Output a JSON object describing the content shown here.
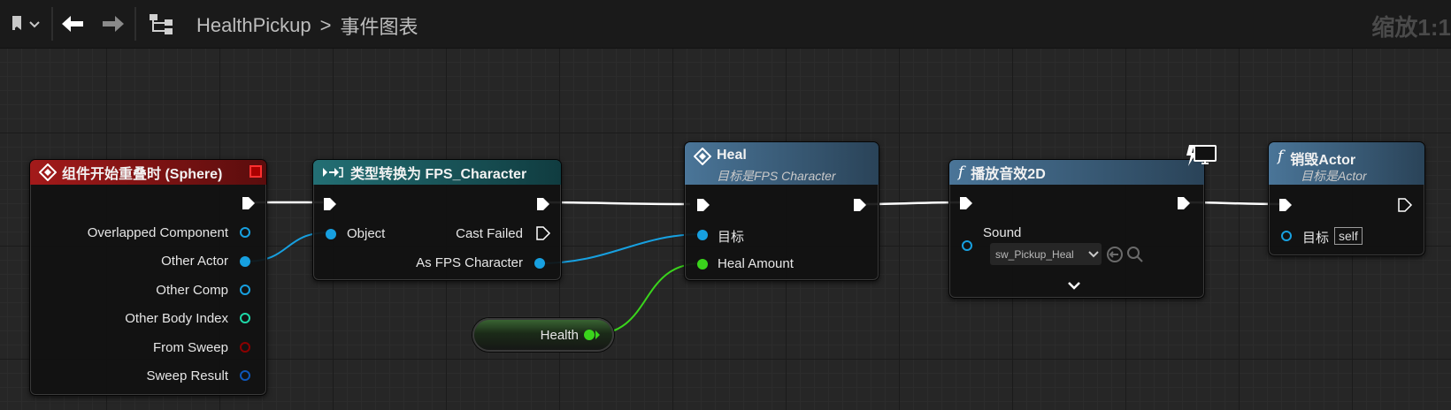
{
  "toolbar": {
    "breadcrumb_root": "HealthPickup",
    "breadcrumb_sep": ">",
    "breadcrumb_current": "事件图表",
    "zoom": "缩放1:1"
  },
  "nodes": {
    "overlap": {
      "title": "组件开始重叠时 (Sphere)",
      "pins": [
        "Overlapped Component",
        "Other Actor",
        "Other Comp",
        "Other Body Index",
        "From Sweep",
        "Sweep Result"
      ]
    },
    "cast": {
      "title": "类型转换为 FPS_Character",
      "object": "Object",
      "cast_failed": "Cast Failed",
      "as_fps": "As FPS Character"
    },
    "heal": {
      "title": "Heal",
      "subtitle": "目标是FPS Character",
      "target": "目标",
      "heal_amount": "Heal Amount"
    },
    "health_var": {
      "label": "Health"
    },
    "play_sound": {
      "title": "播放音效2D",
      "sound_label": "Sound",
      "sound_value": "sw_Pickup_Heal"
    },
    "destroy": {
      "title": "销毁Actor",
      "subtitle": "目标是Actor",
      "target": "目标",
      "self": "self"
    }
  },
  "colors": {
    "event_header": "#8a1515",
    "cast_header": "#1f6b70",
    "function_header": "#3e6c8f",
    "object_pin": "#17a0e0",
    "float_pin": "#3ad41c",
    "int_pin": "#1ed8a8",
    "bool_pin": "#8b0000",
    "struct_pin": "#0e56b8",
    "exec": "#ffffff"
  }
}
